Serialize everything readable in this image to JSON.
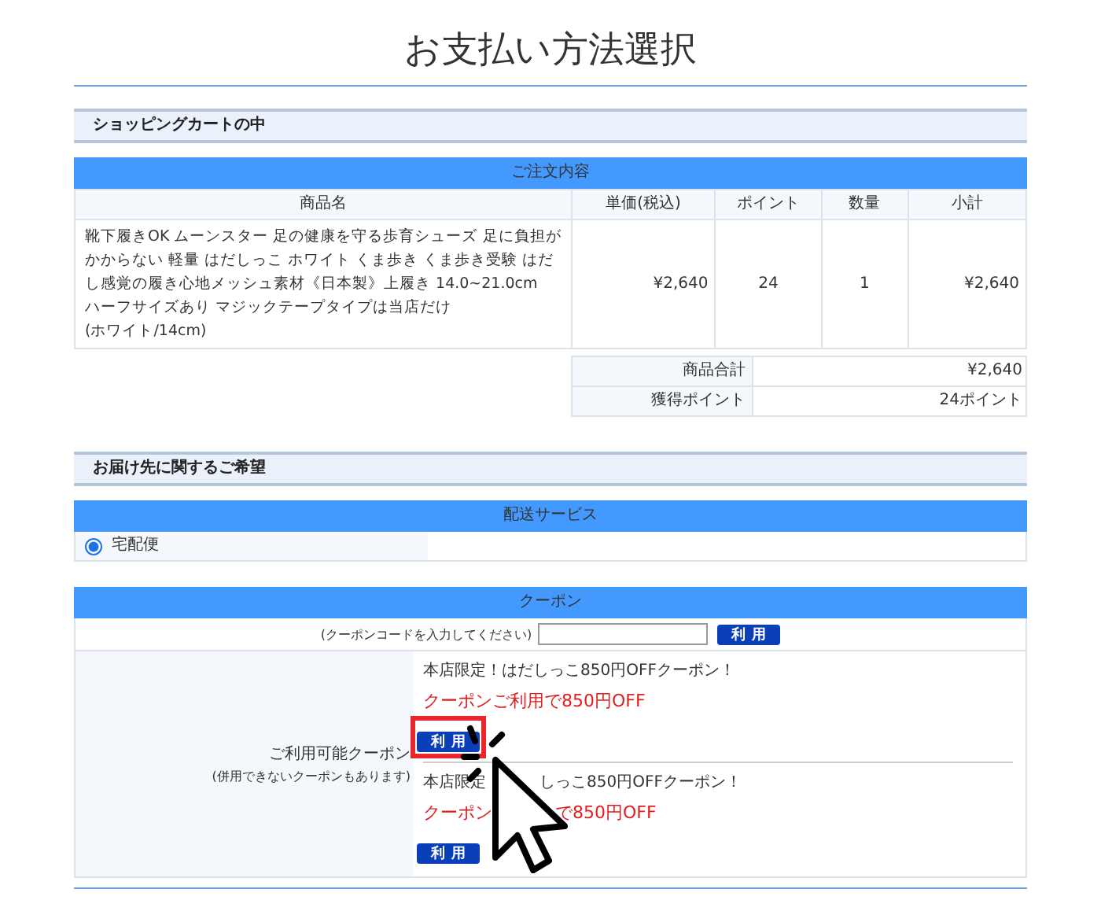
{
  "title": "お支払い方法選択",
  "cart": {
    "heading": "ショッピングカートの中",
    "table_title": "ご注文内容",
    "columns": [
      "商品名",
      "単価(税込)",
      "ポイント",
      "数量",
      "小計"
    ],
    "rows": [
      {
        "name_lines": [
          "靴下履きOK ムーンスター 足の健康を守る歩育シューズ 足に負担が",
          "かからない 軽量 はだしっこ ホワイト くま歩き くま歩き受験 はだ",
          "し感覚の履き心地メッシュ素材《日本製》上履き 14.0~21.0cm",
          "ハーフサイズあり マジックテープタイプは当店だけ",
          "(ホワイト/14cm)"
        ],
        "price": "¥2,640",
        "points": "24",
        "qty": "1",
        "subtotal": "¥2,640"
      }
    ],
    "totals": [
      {
        "label": "商品合計",
        "value": "¥2,640"
      },
      {
        "label": "獲得ポイント",
        "value": "24ポイント"
      }
    ]
  },
  "delivery": {
    "heading": "お届け先に関するご希望",
    "table_title": "配送サービス",
    "options": [
      {
        "label": "宅配便",
        "selected": true
      }
    ]
  },
  "coupon": {
    "table_title": "クーポン",
    "code_label": "(クーポンコードを入力してください)",
    "apply_button": "利用",
    "available_label": "ご利用可能クーポン",
    "available_note": "(併用できないクーポンもあります)",
    "items": [
      {
        "title_parts": [
          "本店限定！はだしっこ850円OFFクーポン！"
        ],
        "offer_parts": [
          "クーポンご利用で850円OFF"
        ],
        "button": "利用",
        "highlighted": true
      },
      {
        "title_parts": [
          "本店限定",
          "しっこ850円OFFクーポン！"
        ],
        "offer_parts": [
          "クーポン",
          "で850円OFF"
        ],
        "button": "利用",
        "highlighted": false
      }
    ]
  }
}
